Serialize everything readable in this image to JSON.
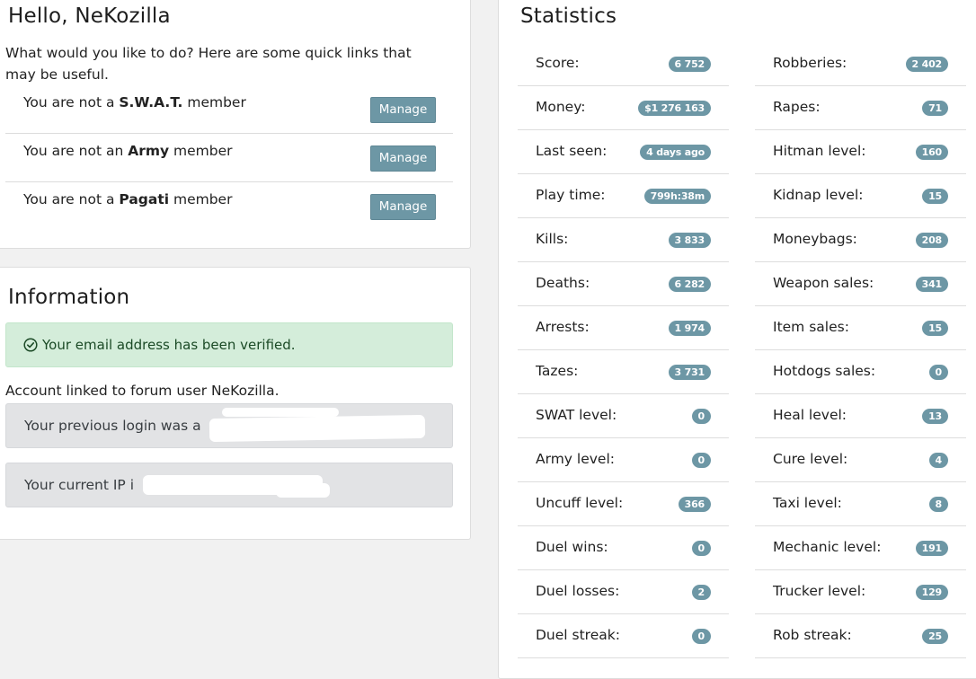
{
  "hello": {
    "title": "Hello, NeKozilla",
    "intro": "What would you like to do? Here are some quick links that may be useful.",
    "members": [
      {
        "prefix": "You are not a ",
        "group": "S.W.A.T.",
        "suffix": " member",
        "button": "Manage"
      },
      {
        "prefix": "You are not an ",
        "group": "Army",
        "suffix": " member",
        "button": "Manage"
      },
      {
        "prefix": "You are not a ",
        "group": "Pagati",
        "suffix": " member",
        "button": "Manage"
      }
    ]
  },
  "information": {
    "title": "Information",
    "verified": "Your email address has been verified.",
    "linked": "Account linked to forum user NeKozilla.",
    "previous_login": "Your previous login was a",
    "current_ip": "Your current IP i"
  },
  "statistics": {
    "title": "Statistics",
    "left": [
      {
        "label": "Score:",
        "value": "6 752"
      },
      {
        "label": "Money:",
        "value": "$1 276 163"
      },
      {
        "label": "Last seen:",
        "value": "4 days ago"
      },
      {
        "label": "Play time:",
        "value": "799h:38m"
      },
      {
        "label": "Kills:",
        "value": "3 833"
      },
      {
        "label": "Deaths:",
        "value": "6 282"
      },
      {
        "label": "Arrests:",
        "value": "1 974"
      },
      {
        "label": "Tazes:",
        "value": "3 731"
      },
      {
        "label": "SWAT level:",
        "value": "0"
      },
      {
        "label": "Army level:",
        "value": "0"
      },
      {
        "label": "Uncuff level:",
        "value": "366"
      },
      {
        "label": "Duel wins:",
        "value": "0"
      },
      {
        "label": "Duel losses:",
        "value": "2"
      },
      {
        "label": "Duel streak:",
        "value": "0"
      }
    ],
    "right": [
      {
        "label": "Robberies:",
        "value": "2 402"
      },
      {
        "label": "Rapes:",
        "value": "71"
      },
      {
        "label": "Hitman level:",
        "value": "160"
      },
      {
        "label": "Kidnap level:",
        "value": "15"
      },
      {
        "label": "Moneybags:",
        "value": "208"
      },
      {
        "label": "Weapon sales:",
        "value": "341"
      },
      {
        "label": "Item sales:",
        "value": "15"
      },
      {
        "label": "Hotdogs sales:",
        "value": "0"
      },
      {
        "label": "Heal level:",
        "value": "13"
      },
      {
        "label": "Cure level:",
        "value": "4"
      },
      {
        "label": "Taxi level:",
        "value": "8"
      },
      {
        "label": "Mechanic level:",
        "value": "191"
      },
      {
        "label": "Trucker level:",
        "value": "129"
      },
      {
        "label": "Rob streak:",
        "value": "25"
      }
    ]
  },
  "colors": {
    "badge": "#6d97a5",
    "alert_success_bg": "#d4edda",
    "alert_grey_bg": "#e2e3e5"
  }
}
